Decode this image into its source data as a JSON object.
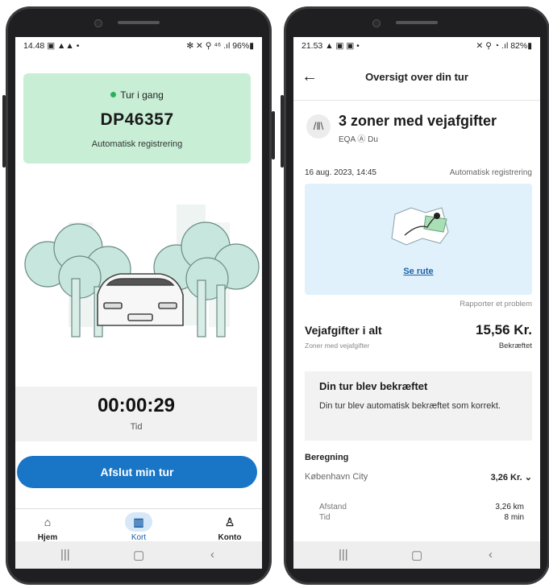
{
  "left_phone": {
    "status": {
      "time_icons": "14.48 ▣ ▲▲ •",
      "right_icons": "✻ ✕ ⚲ ⁴⁶ .ıl 96%▮"
    },
    "trip_status": "Tur i gang",
    "plate": "DP46357",
    "registration": "Automatisk registrering",
    "timer": "00:00:29",
    "timer_label": "Tid",
    "end_button": "Afslut min tur",
    "tabs": [
      {
        "label": "Hjem",
        "icon": "home-icon"
      },
      {
        "label": "Kort",
        "icon": "map-icon"
      },
      {
        "label": "Konto",
        "icon": "person-icon"
      }
    ]
  },
  "right_phone": {
    "status": {
      "time_icons": "21.53 ▲ ▣ ▣ •",
      "right_icons": "✕ ⚲ ◔ .ıl 82%▮"
    },
    "header_title": "Oversigt over din tur",
    "zone_title": "3 zoner med vejafgifter",
    "zone_sub": "EQA Ⓐ Du",
    "date": "16 aug. 2023, 14:45",
    "registration": "Automatisk registrering",
    "map_link": "Se rute",
    "report": "Rapporter et problem",
    "toll_title": "Vejafgifter i alt",
    "toll_amount": "15,56 Kr.",
    "toll_sub": "Zoner med vejafgifter",
    "toll_status": "Bekræftet",
    "confirm_title": "Din tur blev bekræftet",
    "confirm_text": "Din tur blev automatisk bekræftet som korrekt.",
    "calc_label": "Beregning",
    "zone_name": "København City",
    "zone_amount": "3,26 Kr. ⌄",
    "distance_label": "Afstand",
    "distance_value": "3,26 km",
    "time_label": "Tid",
    "time_value": "8 min"
  },
  "colors": {
    "accent": "#1976c6",
    "green_card": "#c8efd6",
    "map_bg": "#e1f1fb"
  }
}
